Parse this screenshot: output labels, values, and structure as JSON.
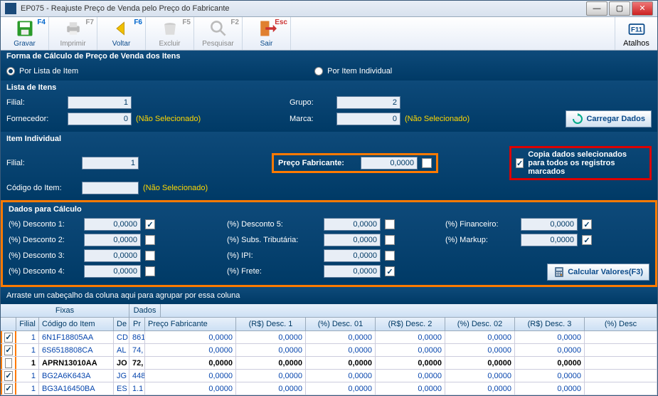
{
  "window": {
    "title": "EP075 - Reajuste Preço de Venda pelo Preço do Fabricante"
  },
  "toolbar": {
    "gravar": {
      "label": "Gravar",
      "key": "F4"
    },
    "imprimir": {
      "label": "Imprimir",
      "key": "F7"
    },
    "voltar": {
      "label": "Voltar",
      "key": "F6"
    },
    "excluir": {
      "label": "Excluir",
      "key": "F5"
    },
    "pesquisar": {
      "label": "Pesquisar",
      "key": "F2"
    },
    "sair": {
      "label": "Sair",
      "key": "Esc"
    },
    "atalhos": {
      "label": "Atalhos",
      "key": "F11"
    }
  },
  "forma": {
    "legend": "Forma de Cálculo de Preço de Venda dos Itens",
    "porLista": "Por Lista de Item",
    "porItem": "Por Item Individual"
  },
  "lista": {
    "legend": "Lista de Itens",
    "filial": "Filial:",
    "filial_val": "1",
    "grupo": "Grupo:",
    "grupo_val": "2",
    "fornecedor": "Fornecedor:",
    "fornecedor_val": "0",
    "marca": "Marca:",
    "marca_val": "0",
    "naosel": "(Não Selecionado)",
    "carregar": "Carregar Dados"
  },
  "item": {
    "legend": "Item Individual",
    "filial": "Filial:",
    "filial_val": "1",
    "codigo": "Código do Item:",
    "naosel": "(Não Selecionado)",
    "precofab": "Preço Fabricante:",
    "precofab_val": "0,0000",
    "copia": "Copia dados selecionados para todos os registros marcados"
  },
  "dados": {
    "legend": "Dados para Cálculo",
    "d1": "(%) Desconto 1:",
    "d1v": "0,0000",
    "d2": "(%) Desconto 2:",
    "d2v": "0,0000",
    "d3": "(%) Desconto 3:",
    "d3v": "0,0000",
    "d4": "(%) Desconto 4:",
    "d4v": "0,0000",
    "d5": "(%) Desconto 5:",
    "d5v": "0,0000",
    "subs": "(%) Subs. Tributária:",
    "subsv": "0,0000",
    "ipi": "(%) IPI:",
    "ipiv": "0,0000",
    "frete": "(%) Frete:",
    "fretev": "0,0000",
    "fin": "(%) Financeiro:",
    "finv": "0,0000",
    "markup": "(%) Markup:",
    "markupv": "0,0000",
    "calc": "Calcular Valores(F3)"
  },
  "grid": {
    "groupHint": "Arraste um cabeçalho da coluna aqui para agrupar por essa coluna",
    "band": {
      "fixas": "Fixas",
      "dados": "Dados"
    },
    "cols": {
      "filial": "Filial",
      "codigo": "Código do Item",
      "de": "De",
      "pr": "Pr",
      "pf": "Preço Fabricante",
      "rs1": "(R$) Desc. 1",
      "p01": "(%) Desc. 01",
      "rs2": "(R$) Desc. 2",
      "p02": "(%) Desc. 02",
      "rs3": "(R$) Desc. 3",
      "p03": "(%) Desc"
    },
    "rows": [
      {
        "chk": true,
        "filial": "1",
        "codigo": "6N1F18805AA",
        "de": "CD",
        "pr": "861",
        "pf": "0,0000",
        "rs1": "0,0000",
        "p01": "0,0000",
        "rs2": "0,0000",
        "p02": "0,0000",
        "rs3": "0,0000"
      },
      {
        "chk": true,
        "filial": "1",
        "codigo": "6S6518808CA",
        "de": "AL",
        "pr": "74,",
        "pf": "0,0000",
        "rs1": "0,0000",
        "p01": "0,0000",
        "rs2": "0,0000",
        "p02": "0,0000",
        "rs3": "0,0000"
      },
      {
        "chk": false,
        "filial": "1",
        "codigo": "APRN13010AA",
        "de": "JO",
        "pr": "72,",
        "pf": "0,0000",
        "rs1": "0,0000",
        "p01": "0,0000",
        "rs2": "0,0000",
        "p02": "0,0000",
        "rs3": "0,0000"
      },
      {
        "chk": true,
        "filial": "1",
        "codigo": "BG2A6K643A",
        "de": "JG",
        "pr": "448",
        "pf": "0,0000",
        "rs1": "0,0000",
        "p01": "0,0000",
        "rs2": "0,0000",
        "p02": "0,0000",
        "rs3": "0,0000"
      },
      {
        "chk": true,
        "filial": "1",
        "codigo": "BG3A16450BA",
        "de": "ES",
        "pr": "1.1",
        "pf": "0,0000",
        "rs1": "0,0000",
        "p01": "0,0000",
        "rs2": "0,0000",
        "p02": "0,0000",
        "rs3": "0,0000"
      }
    ]
  }
}
